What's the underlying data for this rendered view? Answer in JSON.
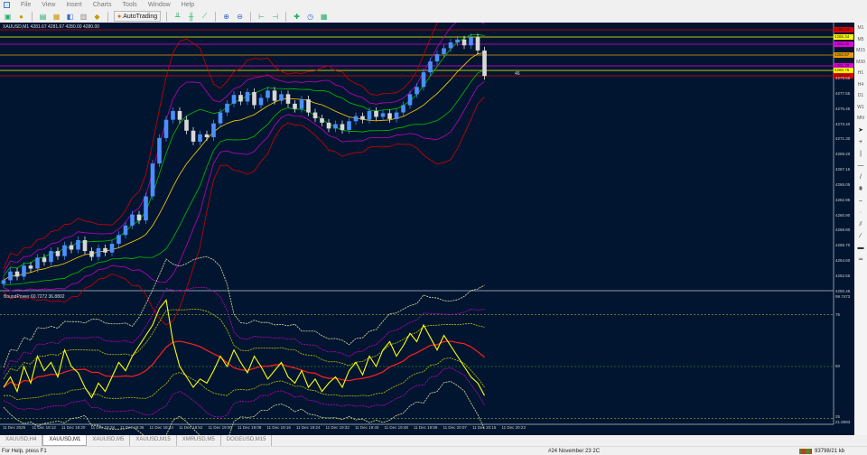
{
  "menu": [
    "File",
    "View",
    "Insert",
    "Charts",
    "Tools",
    "Window",
    "Help"
  ],
  "toolbar": {
    "autotrading": "AutoTrading"
  },
  "chart": {
    "title": "XAUUSD,M1  4281.67 4281.67 4280.00 4280.00",
    "indicator_title": "BoundPower  60.7272  36.8802",
    "countdown": "46",
    "price_axis": [
      "4279.65",
      "4277.55",
      "4275.45",
      "4273.40",
      "4271.30",
      "4269.20",
      "4267.15",
      "4265.05",
      "4262.95",
      "4260.90",
      "4258.80",
      "4256.70",
      "4254.60",
      "4252.55",
      "4250.45"
    ],
    "price_lines": [
      {
        "value": "4286.33",
        "color": "#e00000"
      },
      {
        "value": "4285.34",
        "color": "#ffff00"
      },
      {
        "value": "4284.35",
        "color": "#e000e0"
      },
      {
        "value": "4282.87",
        "color": "#e89a00"
      },
      {
        "value": "4281.38",
        "color": "#e000e0"
      },
      {
        "value": "4280.76",
        "color": "#ffff00"
      },
      {
        "value": "4280.02",
        "color": "#e00000"
      }
    ],
    "indicator_axis": {
      "max": "99.7473",
      "l75": "75",
      "l50": "50",
      "l25": "25",
      "min": "21.8083"
    },
    "time_axis": [
      "11 Dec 2025",
      "11 Dec 18:12",
      "11 Dec 18:20",
      "11 Dec 18:28",
      "11 Dec 18:36",
      "11 Dec 18:44",
      "11 Dec 18:52",
      "11 Dec 19:00",
      "11 Dec 19:08",
      "11 Dec 19:16",
      "11 Dec 19:24",
      "11 Dec 19:32",
      "11 Dec 19:40",
      "11 Dec 19:48",
      "11 Dec 19:59",
      "11 Dec 20:07",
      "11 Dec 20:15",
      "11 Dec 20:23"
    ]
  },
  "chart_data": {
    "type": "candlestick",
    "symbol": "XAUUSD",
    "timeframe": "M1",
    "closes": [
      4252.0,
      4253.2,
      4252.5,
      4254.0,
      4253.6,
      4255.1,
      4254.5,
      4256.0,
      4255.3,
      4256.8,
      4256.2,
      4257.5,
      4256.0,
      4255.2,
      4256.4,
      4255.8,
      4257.0,
      4258.2,
      4259.5,
      4261.0,
      4260.2,
      4263.5,
      4268.0,
      4271.5,
      4274.0,
      4275.2,
      4274.0,
      4272.5,
      4271.0,
      4272.0,
      4271.6,
      4273.5,
      4275.0,
      4276.2,
      4277.4,
      4276.5,
      4277.8,
      4276.0,
      4277.0,
      4278.0,
      4276.6,
      4277.5,
      4276.2,
      4275.5,
      4276.8,
      4275.0,
      4274.2,
      4273.6,
      4272.8,
      4273.4,
      4272.6,
      4273.8,
      4274.5,
      4274.0,
      4275.2,
      4274.4,
      4274.9,
      4274.1,
      4275.0,
      4276.0,
      4277.5,
      4278.5,
      4280.5,
      4282.0,
      4283.0,
      4283.8,
      4284.6,
      4285.0,
      4284.2,
      4285.3,
      4283.5,
      4280.0
    ],
    "oscillator": [
      40,
      45,
      38,
      50,
      42,
      55,
      48,
      52,
      45,
      58,
      50,
      47,
      40,
      35,
      42,
      38,
      45,
      52,
      48,
      55,
      60,
      65,
      70,
      78,
      82,
      62,
      50,
      45,
      40,
      44,
      42,
      48,
      55,
      50,
      58,
      52,
      47,
      55,
      50,
      44,
      48,
      52,
      45,
      42,
      48,
      40,
      44,
      38,
      42,
      45,
      40,
      48,
      52,
      46,
      55,
      50,
      58,
      62,
      55,
      60,
      66,
      62,
      70,
      64,
      58,
      65,
      60,
      55,
      50,
      45,
      42,
      36
    ],
    "ylim": [
      4250.45,
      4286.5
    ],
    "indicator_levels": [
      25,
      50,
      75
    ]
  },
  "tabs": [
    "XAUUSD,H4",
    "XAUUSD,M1",
    "XAUUSD,M5",
    "XAUUSD,M15",
    "XMRUSD,M5",
    "DOGEUSD,M15"
  ],
  "active_tab": 1,
  "rpanel": {
    "timeframes": [
      "M1",
      "M5",
      "M15",
      "M30",
      "H1",
      "H4",
      "D1",
      "W1",
      "MN"
    ]
  },
  "status": {
    "help": "For Help, press F1",
    "profile": "#24 November 23 2C",
    "traffic": "93798/21 kb"
  },
  "colors": {
    "background": "#021530",
    "bull": "#4a90ff",
    "bear": "#ffffff",
    "mid": "#ffd000",
    "inner": "#00c000",
    "middle": "#c000c0",
    "outer": "#d00000",
    "osc": "#ffff00",
    "osc_ma": "#ff2020"
  }
}
